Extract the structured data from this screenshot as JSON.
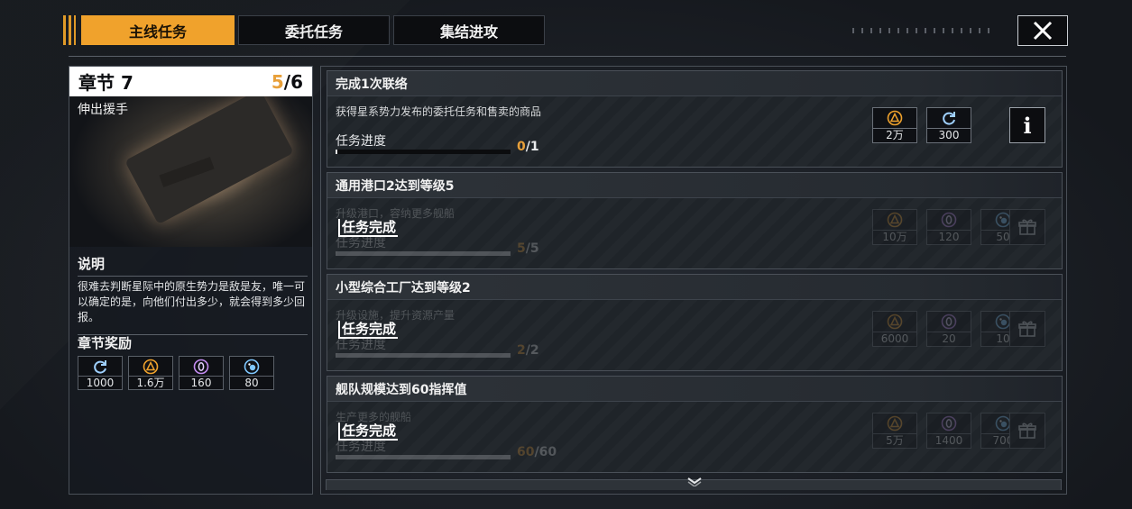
{
  "tabs": [
    {
      "label": "主线任务",
      "active": true
    },
    {
      "label": "委托任务",
      "active": false
    },
    {
      "label": "集结进攻",
      "active": false
    }
  ],
  "chapter": {
    "title": "章节 7",
    "progress_current": "5",
    "progress_total": "/6",
    "subtitle": "伸出援手",
    "desc_title": "说明",
    "desc": "很难去判断星际中的原生势力是敌是友，唯一可以确定的是，向他们付出多少，就会得到多少回报。",
    "reward_title": "章节奖励",
    "rewards": [
      {
        "icon": "refresh-icon",
        "value": "1000"
      },
      {
        "icon": "triangle-coin-icon",
        "value": "1.6万"
      },
      {
        "icon": "zero-crystal-icon",
        "value": "160"
      },
      {
        "icon": "orb-icon",
        "value": "80"
      }
    ]
  },
  "tasks": [
    {
      "title": "完成1次联络",
      "desc": "获得星系势力发布的委托任务和售卖的商品",
      "progress_label": "任务进度",
      "progress_current": "0",
      "progress_total": "/1",
      "progress_fraction": 0,
      "done": false,
      "rewards": [
        {
          "icon": "triangle-coin-icon",
          "value": "2万"
        },
        {
          "icon": "refresh-icon",
          "value": "300"
        }
      ],
      "info_label": "i"
    },
    {
      "title": "通用港口2达到等级5",
      "desc": "升级港口，容纳更多舰船",
      "progress_label": "任务进度",
      "progress_current": "5",
      "progress_total": "/5",
      "progress_fraction": 1,
      "done": true,
      "done_label": "任务完成",
      "rewards": [
        {
          "icon": "triangle-coin-icon",
          "value": "10万"
        },
        {
          "icon": "zero-crystal-icon",
          "value": "120"
        },
        {
          "icon": "orb-icon",
          "value": "50"
        }
      ]
    },
    {
      "title": "小型综合工厂达到等级2",
      "desc": "升级设施，提升资源产量",
      "progress_label": "任务进度",
      "progress_current": "2",
      "progress_total": "/2",
      "progress_fraction": 1,
      "done": true,
      "done_label": "任务完成",
      "rewards": [
        {
          "icon": "triangle-coin-icon",
          "value": "6000"
        },
        {
          "icon": "zero-crystal-icon",
          "value": "20"
        },
        {
          "icon": "orb-icon",
          "value": "10"
        }
      ]
    },
    {
      "title": "舰队规模达到60指挥值",
      "desc": "生产更多的舰船",
      "progress_label": "任务进度",
      "progress_current": "60",
      "progress_total": "/60",
      "progress_fraction": 1,
      "done": true,
      "done_label": "任务完成",
      "rewards": [
        {
          "icon": "triangle-coin-icon",
          "value": "5万"
        },
        {
          "icon": "zero-crystal-icon",
          "value": "1400"
        },
        {
          "icon": "orb-icon",
          "value": "700"
        }
      ]
    }
  ]
}
